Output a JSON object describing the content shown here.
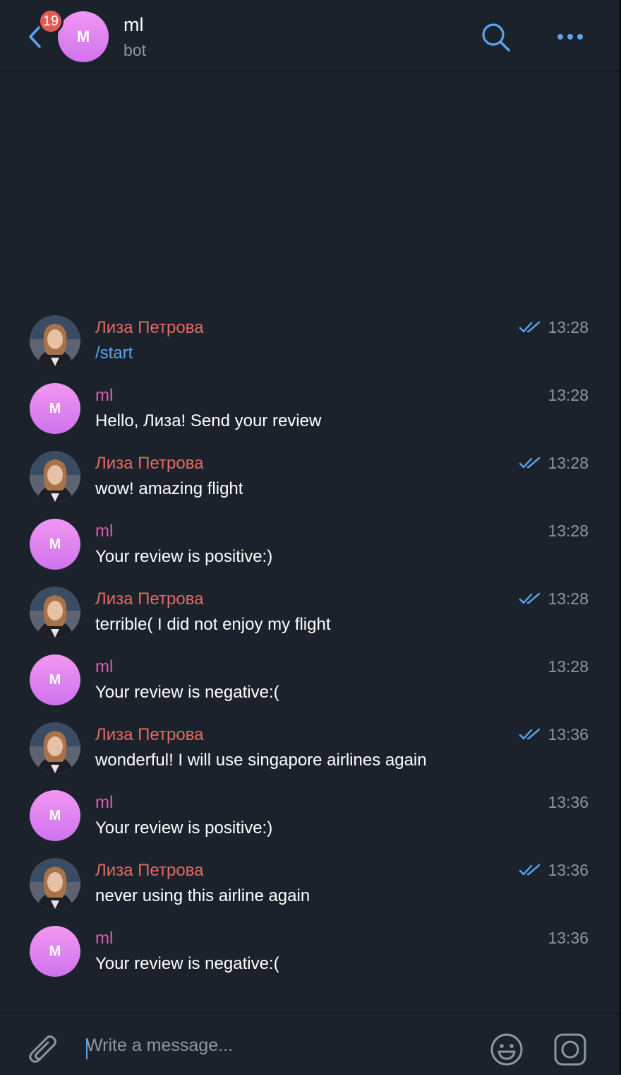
{
  "header": {
    "unread_count": "19",
    "avatar_initial": "M",
    "chat_title": "ml",
    "chat_status": "bot"
  },
  "colors": {
    "background": "#1b222c",
    "accent_blue": "#5aa4f0",
    "badge_red": "#e05a52",
    "user_name": "#e46962",
    "bot_name": "#e05ca8",
    "muted_text": "#8b97a4"
  },
  "messages": [
    {
      "sender": "Лиза Петрова",
      "type": "user",
      "text": "/start",
      "time": "13:28",
      "read": true
    },
    {
      "sender": "ml",
      "type": "bot",
      "avatar_initial": "M",
      "text": "Hello, Лиза! Send your review",
      "time": "13:28"
    },
    {
      "sender": "Лиза Петрова",
      "type": "user",
      "text": "wow! amazing flight",
      "time": "13:28",
      "read": true
    },
    {
      "sender": "ml",
      "type": "bot",
      "avatar_initial": "M",
      "text": "Your review is positive:)",
      "time": "13:28"
    },
    {
      "sender": "Лиза Петрова",
      "type": "user",
      "text": "terrible( I did not enjoy my flight",
      "time": "13:28",
      "read": true
    },
    {
      "sender": "ml",
      "type": "bot",
      "avatar_initial": "M",
      "text": "Your review is negative:(",
      "time": "13:28"
    },
    {
      "sender": "Лиза Петрова",
      "type": "user",
      "text": "wonderful! I will use singapore airlines again",
      "time": "13:36",
      "read": true
    },
    {
      "sender": "ml",
      "type": "bot",
      "avatar_initial": "M",
      "text": "Your review is positive:)",
      "time": "13:36"
    },
    {
      "sender": "Лиза Петрова",
      "type": "user",
      "text": "never using this airline again",
      "time": "13:36",
      "read": true
    },
    {
      "sender": "ml",
      "type": "bot",
      "avatar_initial": "M",
      "text": "Your review is negative:(",
      "time": "13:36"
    }
  ],
  "composer": {
    "placeholder": "Write a message..."
  },
  "icons": {
    "back": "chevron-left-icon",
    "search": "search-icon",
    "more": "more-dots-icon",
    "attach": "paperclip-icon",
    "emoji": "emoji-icon",
    "camera": "camera-icon",
    "read": "double-check-icon"
  }
}
